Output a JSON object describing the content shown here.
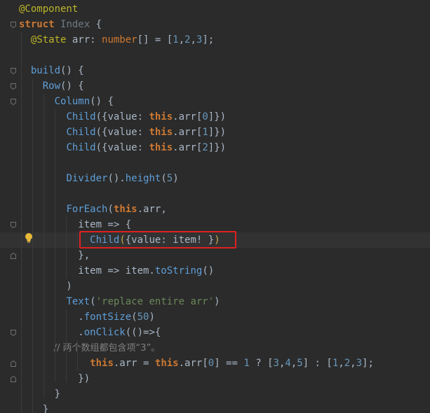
{
  "code_lines": [
    {
      "tokens": [
        {
          "t": "@Component",
          "c": "annot"
        }
      ]
    },
    {
      "tokens": [
        {
          "t": "struct",
          "c": "kw"
        },
        {
          "t": " ",
          "c": "plain"
        },
        {
          "t": "Index",
          "c": "muted-name"
        },
        {
          "t": " {",
          "c": "plain"
        }
      ]
    },
    {
      "tokens": [
        {
          "t": "  @State",
          "c": "annot"
        },
        {
          "t": " arr",
          "c": "plain"
        },
        {
          "t": ": ",
          "c": "plain"
        },
        {
          "t": "number",
          "c": "type"
        },
        {
          "t": "[] = [",
          "c": "plain"
        },
        {
          "t": "1",
          "c": "num"
        },
        {
          "t": ",",
          "c": "plain"
        },
        {
          "t": "2",
          "c": "num"
        },
        {
          "t": ",",
          "c": "plain"
        },
        {
          "t": "3",
          "c": "num"
        },
        {
          "t": "];",
          "c": "plain"
        }
      ]
    },
    {
      "tokens": []
    },
    {
      "tokens": [
        {
          "t": "  ",
          "c": "plain"
        },
        {
          "t": "build",
          "c": "call"
        },
        {
          "t": "() {",
          "c": "plain"
        }
      ]
    },
    {
      "tokens": [
        {
          "t": "    ",
          "c": "plain"
        },
        {
          "t": "Row",
          "c": "call"
        },
        {
          "t": "() {",
          "c": "plain"
        }
      ]
    },
    {
      "tokens": [
        {
          "t": "      ",
          "c": "plain"
        },
        {
          "t": "Column",
          "c": "call"
        },
        {
          "t": "() {",
          "c": "plain"
        }
      ]
    },
    {
      "tokens": [
        {
          "t": "        ",
          "c": "plain"
        },
        {
          "t": "Child",
          "c": "call"
        },
        {
          "t": "({value: ",
          "c": "plain"
        },
        {
          "t": "this",
          "c": "this"
        },
        {
          "t": ".arr[",
          "c": "plain"
        },
        {
          "t": "0",
          "c": "num"
        },
        {
          "t": "]})",
          "c": "plain"
        }
      ]
    },
    {
      "tokens": [
        {
          "t": "        ",
          "c": "plain"
        },
        {
          "t": "Child",
          "c": "call"
        },
        {
          "t": "({value: ",
          "c": "plain"
        },
        {
          "t": "this",
          "c": "this"
        },
        {
          "t": ".arr[",
          "c": "plain"
        },
        {
          "t": "1",
          "c": "num"
        },
        {
          "t": "]})",
          "c": "plain"
        }
      ]
    },
    {
      "tokens": [
        {
          "t": "        ",
          "c": "plain"
        },
        {
          "t": "Child",
          "c": "call"
        },
        {
          "t": "({value: ",
          "c": "plain"
        },
        {
          "t": "this",
          "c": "this"
        },
        {
          "t": ".arr[",
          "c": "plain"
        },
        {
          "t": "2",
          "c": "num"
        },
        {
          "t": "]})",
          "c": "plain"
        }
      ]
    },
    {
      "tokens": []
    },
    {
      "tokens": [
        {
          "t": "        ",
          "c": "plain"
        },
        {
          "t": "Divider",
          "c": "call"
        },
        {
          "t": "().",
          "c": "plain"
        },
        {
          "t": "height",
          "c": "call"
        },
        {
          "t": "(",
          "c": "plain"
        },
        {
          "t": "5",
          "c": "num"
        },
        {
          "t": ")",
          "c": "plain"
        }
      ]
    },
    {
      "tokens": []
    },
    {
      "tokens": [
        {
          "t": "        ",
          "c": "plain"
        },
        {
          "t": "ForEach",
          "c": "call"
        },
        {
          "t": "(",
          "c": "plain"
        },
        {
          "t": "this",
          "c": "this"
        },
        {
          "t": ".arr,",
          "c": "plain"
        }
      ]
    },
    {
      "tokens": [
        {
          "t": "          item => {",
          "c": "plain"
        }
      ]
    },
    {
      "tokens": [
        {
          "t": "            ",
          "c": "plain"
        },
        {
          "t": "Child",
          "c": "call"
        },
        {
          "t": "(",
          "c": "muted"
        },
        {
          "t": "{value: item! }",
          "c": "plain"
        },
        {
          "t": ")",
          "c": "muted"
        }
      ]
    },
    {
      "tokens": [
        {
          "t": "          },",
          "c": "plain"
        }
      ]
    },
    {
      "tokens": [
        {
          "t": "          item => item.",
          "c": "plain"
        },
        {
          "t": "toString",
          "c": "call"
        },
        {
          "t": "()",
          "c": "plain"
        }
      ]
    },
    {
      "tokens": [
        {
          "t": "        )",
          "c": "plain"
        }
      ]
    },
    {
      "tokens": [
        {
          "t": "        ",
          "c": "plain"
        },
        {
          "t": "Text",
          "c": "call"
        },
        {
          "t": "(",
          "c": "plain"
        },
        {
          "t": "'replace entire arr'",
          "c": "str"
        },
        {
          "t": ")",
          "c": "plain"
        }
      ]
    },
    {
      "tokens": [
        {
          "t": "          .",
          "c": "plain"
        },
        {
          "t": "fontSize",
          "c": "call"
        },
        {
          "t": "(",
          "c": "plain"
        },
        {
          "t": "50",
          "c": "num"
        },
        {
          "t": ")",
          "c": "plain"
        }
      ]
    },
    {
      "tokens": [
        {
          "t": "          .",
          "c": "plain"
        },
        {
          "t": "onClick",
          "c": "call"
        },
        {
          "t": "(()=>{",
          "c": "plain"
        }
      ]
    },
    {
      "tokens": [
        {
          "t": "            // 两个数组都包含项“3”。",
          "c": "comment"
        }
      ]
    },
    {
      "tokens": [
        {
          "t": "            ",
          "c": "plain"
        },
        {
          "t": "this",
          "c": "this"
        },
        {
          "t": ".arr = ",
          "c": "plain"
        },
        {
          "t": "this",
          "c": "this"
        },
        {
          "t": ".arr[",
          "c": "plain"
        },
        {
          "t": "0",
          "c": "num"
        },
        {
          "t": "] == ",
          "c": "plain"
        },
        {
          "t": "1",
          "c": "num"
        },
        {
          "t": " ? [",
          "c": "plain"
        },
        {
          "t": "3",
          "c": "num"
        },
        {
          "t": ",",
          "c": "plain"
        },
        {
          "t": "4",
          "c": "num"
        },
        {
          "t": ",",
          "c": "plain"
        },
        {
          "t": "5",
          "c": "num"
        },
        {
          "t": "] : [",
          "c": "plain"
        },
        {
          "t": "1",
          "c": "num"
        },
        {
          "t": ",",
          "c": "plain"
        },
        {
          "t": "2",
          "c": "num"
        },
        {
          "t": ",",
          "c": "plain"
        },
        {
          "t": "3",
          "c": "num"
        },
        {
          "t": "];",
          "c": "plain"
        }
      ]
    },
    {
      "tokens": [
        {
          "t": "          })",
          "c": "plain"
        }
      ]
    },
    {
      "tokens": [
        {
          "t": "      }",
          "c": "plain"
        }
      ]
    },
    {
      "tokens": [
        {
          "t": "    }",
          "c": "plain"
        }
      ]
    }
  ],
  "highlighted_line_index": 15,
  "colors": {
    "background": "#2b2b2b",
    "annotation": "#bbb529",
    "keyword": "#cc7832",
    "function_call": "#5f9fd8",
    "number": "#6897bb",
    "string": "#6a8759",
    "comment": "#808080",
    "text": "#a9b7c6",
    "box_border": "#e02020"
  },
  "icons": {
    "bulb": "lightbulb-icon",
    "fold": "fold-marker-icon"
  }
}
